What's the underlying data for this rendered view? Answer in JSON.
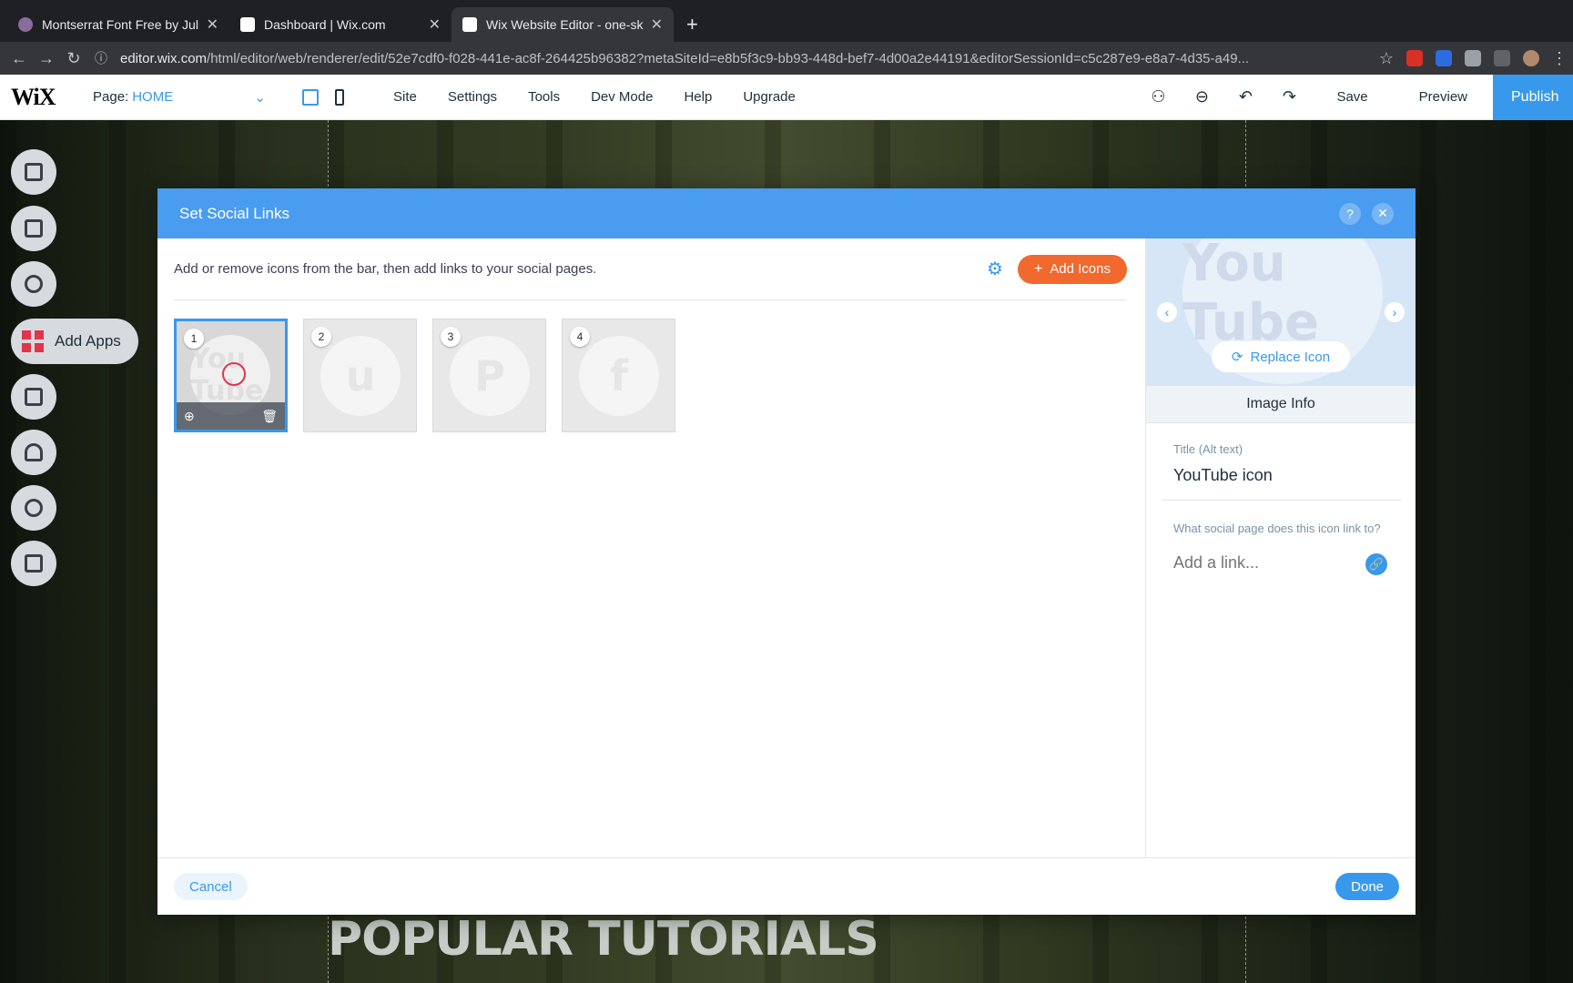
{
  "browser": {
    "tabs": [
      {
        "title": "Montserrat Font Free by Juliet",
        "close": "✕"
      },
      {
        "title": "Dashboard | Wix.com",
        "close": "✕"
      },
      {
        "title": "Wix Website Editor - one-skill",
        "close": "✕"
      }
    ],
    "new_tab": "+",
    "url_host": "editor.wix.com",
    "url_path": "/html/editor/web/renderer/edit/52e7cdf0-f028-441e-ac8f-264425b96382?metaSiteId=e8b5f3c9-bb93-448d-bef7-4d00a2e44191&editorSessionId=c5c287e9-e8a7-4d35-a49..."
  },
  "editor": {
    "logo": "WiX",
    "page_label": "Page:",
    "page_value": "HOME",
    "menu": [
      "Site",
      "Settings",
      "Tools",
      "Dev Mode",
      "Help",
      "Upgrade"
    ],
    "save": "Save",
    "preview": "Preview",
    "publish": "Publish",
    "add_apps": "Add Apps"
  },
  "canvas": {
    "heading": "POPULAR TUTORIALS"
  },
  "modal": {
    "title": "Set Social Links",
    "help": "?",
    "close": "✕",
    "instructions": "Add or remove icons from the bar, then add links to your social pages.",
    "add_icons": "Add Icons",
    "icons": [
      {
        "num": "1",
        "glyph": "You Tube",
        "icon": "youtube-icon"
      },
      {
        "num": "2",
        "glyph": "u",
        "icon": "udemy-icon"
      },
      {
        "num": "3",
        "glyph": "P",
        "icon": "patreon-icon"
      },
      {
        "num": "4",
        "glyph": "f",
        "icon": "facebook-icon"
      }
    ],
    "preview_glyph": "You Tube",
    "replace_icon": "Replace Icon",
    "image_info": "Image Info",
    "alt_label": "Title (Alt text)",
    "alt_value": "YouTube icon",
    "link_label": "What social page does this icon link to?",
    "link_placeholder": "Add a link...",
    "cancel": "Cancel",
    "done": "Done"
  },
  "colors": {
    "accent": "#3899ec",
    "header": "#4a9cf0",
    "add_icons": "#f2692d",
    "publish": "#3899ec"
  }
}
